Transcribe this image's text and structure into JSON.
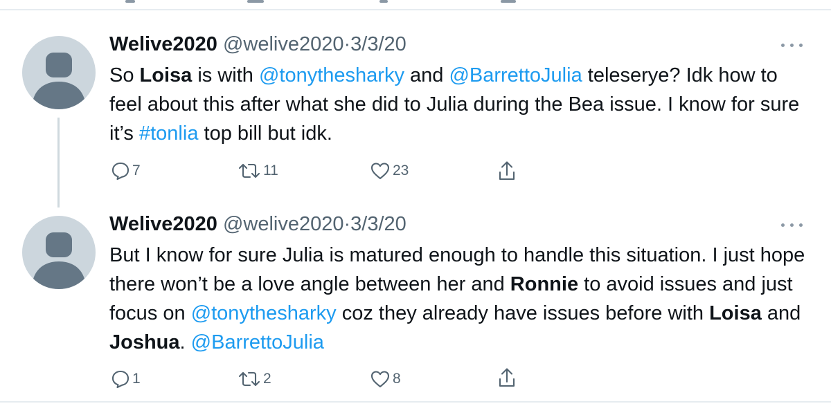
{
  "tweets": [
    {
      "name": "Welive2020",
      "handle": "@welive2020",
      "separator": "·",
      "date": "3/3/20",
      "text": {
        "p1": "So ",
        "b1": "Loisa",
        "p2": " is with ",
        "m1": "@tonythesharky",
        "p3": " and ",
        "m2": "@BarrettoJulia",
        "p4": " teleserye? Idk how to feel about this after what she did to Julia during the Bea issue. I know for sure it’s ",
        "m3": "#tonlia",
        "p5": " top bill but idk."
      },
      "actions": {
        "replies": "7",
        "retweets": "11",
        "likes": "23"
      }
    },
    {
      "name": "Welive2020",
      "handle": "@welive2020",
      "separator": "·",
      "date": "3/3/20",
      "text": {
        "p1": "But I know for sure Julia is matured enough to handle this situation. I just hope there won’t be a love angle between her and ",
        "b1": "Ronnie",
        "p2": " to avoid issues and just focus on ",
        "m1": "@tonythesharky",
        "p3": " coz they already have issues before with ",
        "b2": "Loisa",
        "p4": " and ",
        "b3": "Joshua",
        "p5": ". ",
        "m2": "@BarrettoJulia"
      },
      "actions": {
        "replies": "1",
        "retweets": "2",
        "likes": "8"
      }
    }
  ],
  "icons": {
    "avatar": "default-avatar-icon",
    "more": "more-options-icon",
    "reply": "reply-icon",
    "retweet": "retweet-icon",
    "like": "like-icon",
    "share": "share-icon"
  },
  "colors": {
    "link": "#1d9bf0",
    "secondary_text": "#536471",
    "icon": "#536471",
    "avatar_bg": "#ccd6dd",
    "avatar_fg": "#657786",
    "divider": "#e6ecf0"
  }
}
